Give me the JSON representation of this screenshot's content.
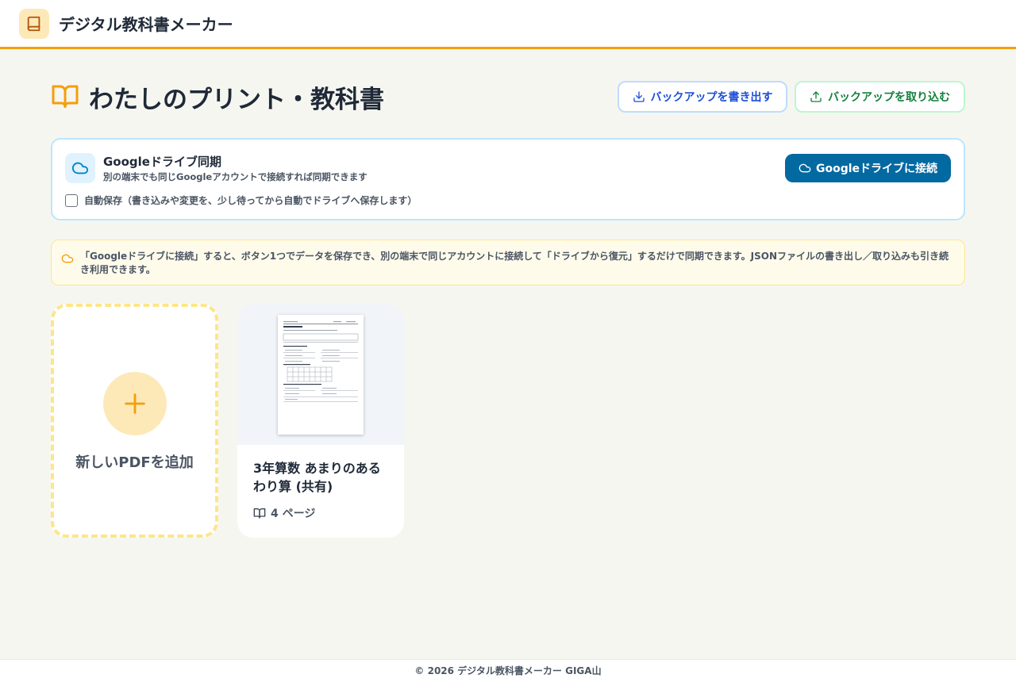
{
  "app": {
    "title": "デジタル教科書メーカー"
  },
  "page": {
    "title": "わたしのプリント・教科書"
  },
  "toolbar": {
    "export_label": "バックアップを書き出す",
    "import_label": "バックアップを取り込む"
  },
  "drive": {
    "title": "Googleドライブ同期",
    "subtitle": "別の端末でも同じGoogleアカウントで接続すれば同期できます",
    "autosave_label": "自動保存（書き込みや変更を、少し待ってから自動でドライブへ保存します）",
    "autosave_checked": false,
    "connect_label": "Googleドライブに接続"
  },
  "notice": {
    "text": "「Googleドライブに接続」すると、ボタン1つでデータを保存でき、別の端末で同じアカウントに接続して「ドライブから復元」するだけで同期できます。JSONファイルの書き出し／取り込みも引き続き利用できます。"
  },
  "add_card": {
    "label": "新しいPDFを追加"
  },
  "books": [
    {
      "title": "3年算数 あまりのあるわり算 (共有)",
      "pages": "4 ページ"
    }
  ],
  "footer": {
    "text": "© 2026 デジタル教科書メーカー GIGA山"
  },
  "colors": {
    "accent": "#f59e0b",
    "primary_button": "#0369a1",
    "export_text": "#1d4ed8",
    "import_text": "#15803d"
  }
}
